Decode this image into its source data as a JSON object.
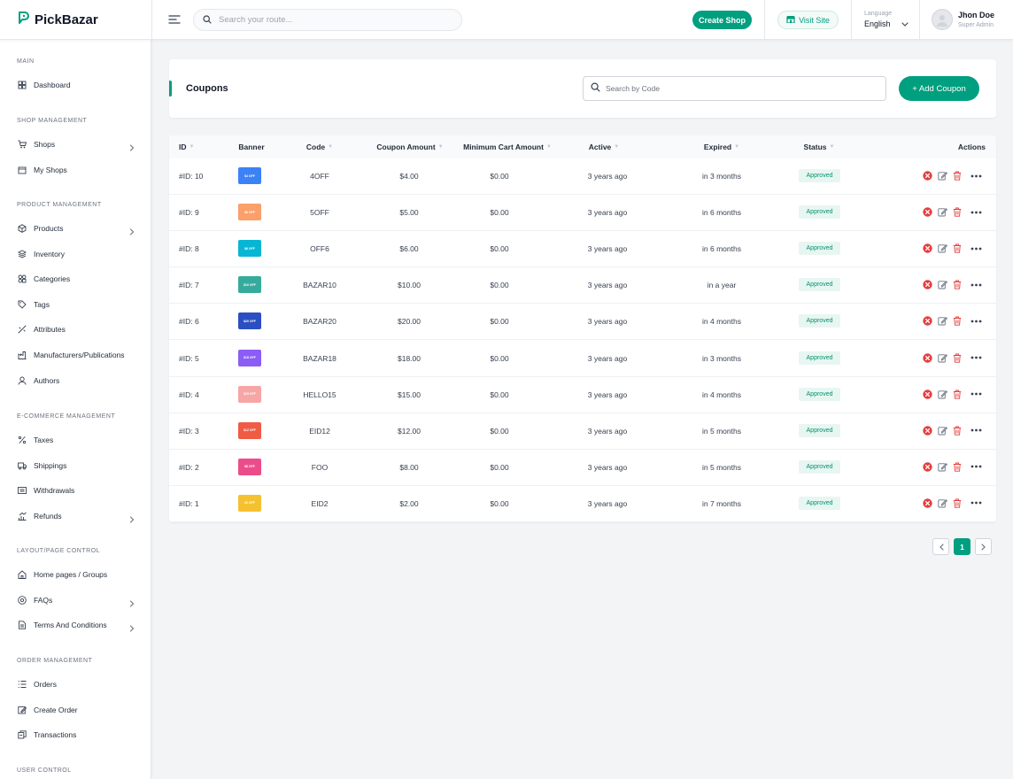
{
  "brand": {
    "name": "PickBazar",
    "accent": "#009f7f"
  },
  "header": {
    "search_placeholder": "Search your route...",
    "create_shop": "Create Shop",
    "visit_site": "Visit Site",
    "language_label": "Language",
    "language_value": "English",
    "user_name": "Jhon Doe",
    "user_role": "Super Admin"
  },
  "sidebar": {
    "sections": [
      {
        "title": "MAIN",
        "items": [
          {
            "label": "Dashboard",
            "icon": "dashboard-icon",
            "chevron": false
          }
        ]
      },
      {
        "title": "SHOP MANAGEMENT",
        "items": [
          {
            "label": "Shops",
            "icon": "shop-icon",
            "chevron": true
          },
          {
            "label": "My Shops",
            "icon": "my-shops-icon",
            "chevron": false
          }
        ]
      },
      {
        "title": "PRODUCT MANAGEMENT",
        "items": [
          {
            "label": "Products",
            "icon": "product-icon",
            "chevron": true
          },
          {
            "label": "Inventory",
            "icon": "inventory-icon",
            "chevron": false
          },
          {
            "label": "Categories",
            "icon": "categories-icon",
            "chevron": false
          },
          {
            "label": "Tags",
            "icon": "tag-icon",
            "chevron": false
          },
          {
            "label": "Attributes",
            "icon": "attributes-icon",
            "chevron": false
          },
          {
            "label": "Manufacturers/Publications",
            "icon": "manufacturer-icon",
            "chevron": false
          },
          {
            "label": "Authors",
            "icon": "author-icon",
            "chevron": false
          }
        ]
      },
      {
        "title": "E-COMMERCE MANAGEMENT",
        "items": [
          {
            "label": "Taxes",
            "icon": "tax-icon",
            "chevron": false
          },
          {
            "label": "Shippings",
            "icon": "shipping-icon",
            "chevron": false
          },
          {
            "label": "Withdrawals",
            "icon": "withdrawal-icon",
            "chevron": false
          },
          {
            "label": "Refunds",
            "icon": "refund-icon",
            "chevron": true
          }
        ]
      },
      {
        "title": "LAYOUT/PAGE CONTROL",
        "items": [
          {
            "label": "Home pages / Groups",
            "icon": "home-icon",
            "chevron": false
          },
          {
            "label": "FAQs",
            "icon": "faq-icon",
            "chevron": true
          },
          {
            "label": "Terms And Conditions",
            "icon": "document-icon",
            "chevron": true
          }
        ]
      },
      {
        "title": "ORDER MANAGEMENT",
        "items": [
          {
            "label": "Orders",
            "icon": "orders-icon",
            "chevron": false
          },
          {
            "label": "Create Order",
            "icon": "create-order-icon",
            "chevron": false
          },
          {
            "label": "Transactions",
            "icon": "transactions-icon",
            "chevron": false
          }
        ]
      },
      {
        "title": "USER CONTROL",
        "items": []
      }
    ]
  },
  "page": {
    "title": "Coupons",
    "search_placeholder": "Search by Code",
    "add_button": "+ Add Coupon"
  },
  "table": {
    "columns": [
      "ID",
      "Banner",
      "Code",
      "Coupon Amount",
      "Minimum Cart Amount",
      "Active",
      "Expired",
      "Status",
      "Actions"
    ],
    "rows": [
      {
        "id": "#ID: 10",
        "banner_text": "$4 OFF",
        "banner_color": "#3b82f6",
        "code": "4OFF",
        "amount": "$4.00",
        "min_cart": "$0.00",
        "active": "3 years ago",
        "expired": "in 3 months",
        "status": "Approved"
      },
      {
        "id": "#ID: 9",
        "banner_text": "$5 OFF",
        "banner_color": "#fb9f6b",
        "code": "5OFF",
        "amount": "$5.00",
        "min_cart": "$0.00",
        "active": "3 years ago",
        "expired": "in 6 months",
        "status": "Approved"
      },
      {
        "id": "#ID: 8",
        "banner_text": "$6 OFF",
        "banner_color": "#06b6d4",
        "code": "OFF6",
        "amount": "$6.00",
        "min_cart": "$0.00",
        "active": "3 years ago",
        "expired": "in 6 months",
        "status": "Approved"
      },
      {
        "id": "#ID: 7",
        "banner_text": "$10 OFF",
        "banner_color": "#37ab9b",
        "code": "BAZAR10",
        "amount": "$10.00",
        "min_cart": "$0.00",
        "active": "3 years ago",
        "expired": "in a year",
        "status": "Approved"
      },
      {
        "id": "#ID: 6",
        "banner_text": "$20 OFF",
        "banner_color": "#2b4fc2",
        "code": "BAZAR20",
        "amount": "$20.00",
        "min_cart": "$0.00",
        "active": "3 years ago",
        "expired": "in 4 months",
        "status": "Approved"
      },
      {
        "id": "#ID: 5",
        "banner_text": "$18 OFF",
        "banner_color": "#8b5cf6",
        "code": "BAZAR18",
        "amount": "$18.00",
        "min_cart": "$0.00",
        "active": "3 years ago",
        "expired": "in 3 months",
        "status": "Approved"
      },
      {
        "id": "#ID: 4",
        "banner_text": "$15 OFF",
        "banner_color": "#f8a5a5",
        "code": "HELLO15",
        "amount": "$15.00",
        "min_cart": "$0.00",
        "active": "3 years ago",
        "expired": "in 4 months",
        "status": "Approved"
      },
      {
        "id": "#ID: 3",
        "banner_text": "$12 OFF",
        "banner_color": "#ef5b45",
        "code": "EID12",
        "amount": "$12.00",
        "min_cart": "$0.00",
        "active": "3 years ago",
        "expired": "in 5 months",
        "status": "Approved"
      },
      {
        "id": "#ID: 2",
        "banner_text": "$8 OFF",
        "banner_color": "#ec4d8a",
        "code": "FOO",
        "amount": "$8.00",
        "min_cart": "$0.00",
        "active": "3 years ago",
        "expired": "in 5 months",
        "status": "Approved"
      },
      {
        "id": "#ID: 1",
        "banner_text": "$2 OFF",
        "banner_color": "#f5c131",
        "code": "EID2",
        "amount": "$2.00",
        "min_cart": "$0.00",
        "active": "3 years ago",
        "expired": "in 7 months",
        "status": "Approved"
      }
    ]
  },
  "pagination": {
    "current": "1"
  }
}
